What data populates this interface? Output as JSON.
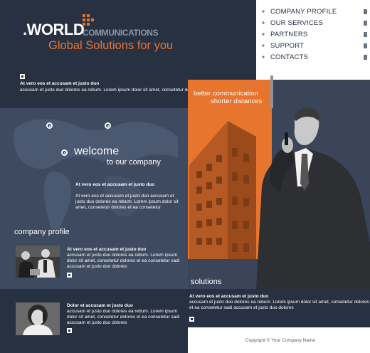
{
  "brand": {
    "name": ".WORLD",
    "suffix": "COMMUNICATIONS",
    "tagline": "Global Solutions for you"
  },
  "nav": {
    "items": [
      {
        "label": "COMPANY PROFILE"
      },
      {
        "label": "OUR SERVICES"
      },
      {
        "label": "PARTNERS"
      },
      {
        "label": "SUPPORT"
      },
      {
        "label": "CONTACTS"
      }
    ]
  },
  "header_news": {
    "title": "At vero eos et accusam et justo duo",
    "body": "accusam et justo duo dolores ea rebum. Lorem ipsum dolor sit amet, consetetur dolores et ea consetetur"
  },
  "hero": {
    "line1": "better communication",
    "line2": "shorter distances",
    "solutions": "solutions"
  },
  "welcome": {
    "heading": "welcome",
    "subheading": "to our company",
    "title": "At vero eos et accusam et justo duo",
    "body": "At vero eos et accusam et justo duo accusam et justo duo dolores ea rebum. Lorem ipsum dolor sit amet, consetetur dolores et ea consetetur"
  },
  "company_profile": {
    "heading": "company profile",
    "title": "At vero eos et accusam et justo duo",
    "body": "accusam et justo duo dolores ea rebum. Lorem ipsum dolor sit amet, consetetur dolores et ea consetetur sadi accusam et justo duo dolores"
  },
  "bottom_left": {
    "title": "Dolor et accusam et justo duo",
    "body": "accusam et justo duo dolores ea rebum. Lorem ipsum dolor sit amet, consetetur dolores et ea consetetur sadi accusam et justo duo dolores"
  },
  "bottom_right": {
    "title": "At vero eos et accusam et justo duo",
    "body": "accusam et justo duo dolores ea rebum. Lorem ipsum dolor sit amet, consetetur dolores et ea consetetur sadi accusam et justo duo dolores"
  },
  "footer": {
    "copyright": "Copyright © Your Company Name"
  },
  "colors": {
    "navy": "#273142",
    "slate": "#3d4a60",
    "orange": "#e8752d",
    "white": "#ffffff"
  }
}
